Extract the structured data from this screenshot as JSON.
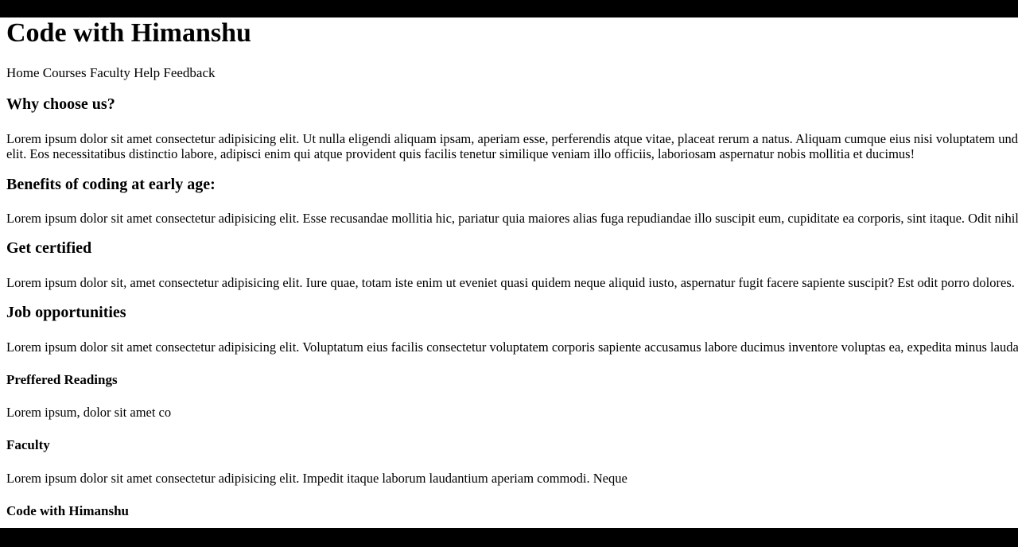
{
  "site_title": "Code with Himanshu",
  "nav": {
    "items": [
      "Home",
      "Courses",
      "Faculty",
      "Help",
      "Feedback"
    ]
  },
  "sections": [
    {
      "heading": "Why choose us?",
      "line1": "Lorem ipsum dolor sit amet consectetur adipisicing elit. Ut nulla eligendi aliquam ipsam, aperiam esse, perferendis atque vitae, placeat rerum a natus. Aliquam cumque eius nisi voluptatem unde",
      "line2": "elit. Eos necessitatibus distinctio labore, adipisci enim qui atque provident quis facilis tenetur similique veniam illo officiis, laboriosam aspernatur nobis mollitia et ducimus!"
    },
    {
      "heading": "Benefits of coding at early age:",
      "line1": "Lorem ipsum dolor sit amet consectetur adipisicing elit. Esse recusandae mollitia hic, pariatur quia maiores alias fuga repudiandae illo suscipit eum, cupiditate ea corporis, sint itaque. Odit nihil"
    },
    {
      "heading": "Get certified",
      "line1": "Lorem ipsum dolor sit, amet consectetur adipisicing elit. Iure quae, totam iste enim ut eveniet quasi quidem neque aliquid iusto, aspernatur fugit facere sapiente suscipit? Est odit porro dolores. I"
    },
    {
      "heading": "Job opportunities",
      "line1": "Lorem ipsum dolor sit amet consectetur adipisicing elit. Voluptatum eius facilis consectetur voluptatem corporis sapiente accusamus labore ducimus inventore voluptas ea, expedita minus laudan"
    }
  ],
  "footer": {
    "readings_heading": "Preffered Readings",
    "readings_text": "Lorem ipsum, dolor sit amet co",
    "faculty_heading": "Faculty",
    "faculty_text": "Lorem ipsum dolor sit amet consectetur adipisicing elit. Impedit itaque laborum laudantium aperiam commodi. Neque",
    "brand_heading": "Code with Himanshu"
  }
}
